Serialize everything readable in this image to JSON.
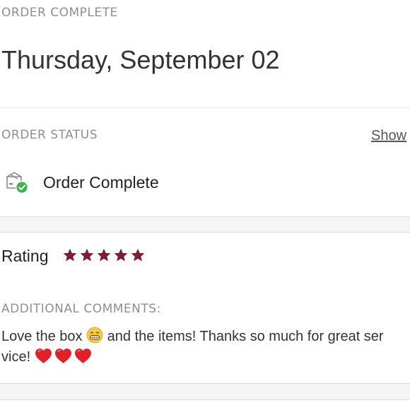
{
  "header": {
    "eyebrow": "ORDER COMPLETE",
    "date": "Thursday, September 02"
  },
  "order_status": {
    "label": "ORDER STATUS",
    "show_link": "Show",
    "status_text": "Order Complete",
    "status_icon": "box-check-icon"
  },
  "rating": {
    "label": "Rating",
    "value": 5,
    "max": 5,
    "star_color": "#7b1f2e"
  },
  "comments": {
    "label": "ADDITIONAL COMMENTS:",
    "text_part1": "Love the box",
    "emoji_1": "grinning-face-emoji",
    "text_part2": "and the items! Thanks so much for great ser",
    "text_part3": "vice!",
    "emoji_2": "red-heart-emoji"
  },
  "colors": {
    "check_green": "#3db54a",
    "heading_gray": "#8f8f8f"
  }
}
